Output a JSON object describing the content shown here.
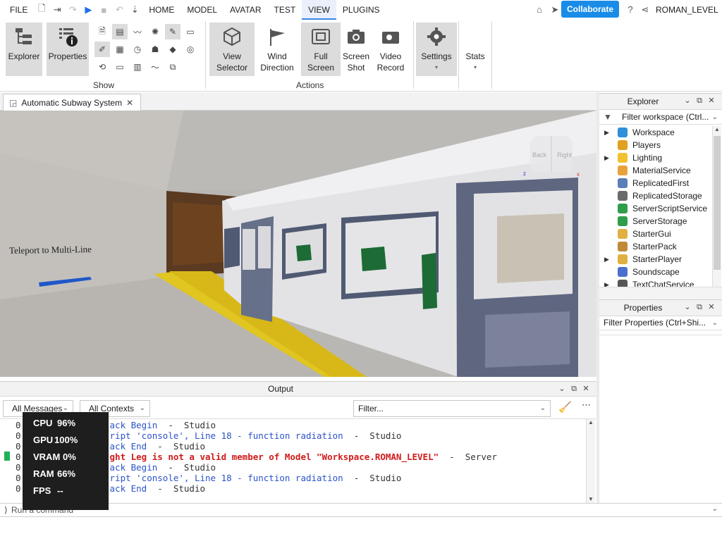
{
  "menu": {
    "items": [
      "FILE",
      "HOME",
      "MODEL",
      "AVATAR",
      "TEST",
      "VIEW",
      "PLUGINS"
    ],
    "active": "VIEW",
    "collaborate": "Collaborate",
    "username": "ROMAN_LEVEL"
  },
  "ribbon": {
    "explorer": "Explorer",
    "properties": "Properties",
    "show_group": "Show",
    "view_selector_1": "View",
    "view_selector_2": "Selector",
    "wind_1": "Wind",
    "wind_2": "Direction",
    "full_1": "Full",
    "full_2": "Screen",
    "shot_1": "Screen",
    "shot_2": "Shot",
    "video_1": "Video",
    "video_2": "Record",
    "actions_group": "Actions",
    "settings": "Settings",
    "stats": "Stats"
  },
  "doc_tab": "Automatic Subway System",
  "viewport": {
    "teleport_text": "Teleport to Multi-Line",
    "viewcube_left": "Back",
    "viewcube_right": "Right"
  },
  "output": {
    "title": "Output",
    "filter1": "All Messages",
    "filter2": "All Contexts",
    "search_placeholder": "Filter...",
    "lines": [
      {
        "prefix": "0",
        "a": "ack Begin",
        "b": "  -  Studio",
        "kind": "blue"
      },
      {
        "prefix": "0",
        "a": "ript 'console', Line 18 - function radiation",
        "b": "  -  Studio",
        "kind": "blue"
      },
      {
        "prefix": "0",
        "a": "ack End",
        "b": "  -  Studio",
        "kind": "blue"
      },
      {
        "prefix": "0",
        "a": "ght Leg is not a valid member of Model \"Workspace.ROMAN_LEVEL\"",
        "b": "  -  Server",
        "kind": "red"
      },
      {
        "prefix": "0",
        "a": "ack Begin",
        "b": "  -  Studio",
        "kind": "blue"
      },
      {
        "prefix": "0",
        "a": "ript 'console', Line 18 - function radiation",
        "b": "  -  Studio",
        "kind": "blue"
      },
      {
        "prefix": "0",
        "a": "ack End",
        "b": "  -  Studio",
        "kind": "blue"
      }
    ]
  },
  "command_placeholder": "Run a command",
  "perf": [
    {
      "label": "CPU",
      "value": "96%"
    },
    {
      "label": "GPU",
      "value": "100%"
    },
    {
      "label": "VRAM",
      "value": "0%"
    },
    {
      "label": "RAM",
      "value": "66%"
    },
    {
      "label": "FPS",
      "value": "--"
    }
  ],
  "explorer": {
    "title": "Explorer",
    "filter": "Filter workspace (Ctrl...",
    "items": [
      {
        "label": "Workspace",
        "expandable": true,
        "color": "#2f8fd8"
      },
      {
        "label": "Players",
        "expandable": false,
        "color": "#e0a020"
      },
      {
        "label": "Lighting",
        "expandable": true,
        "color": "#f2c12e"
      },
      {
        "label": "MaterialService",
        "expandable": false,
        "color": "#e8a23a"
      },
      {
        "label": "ReplicatedFirst",
        "expandable": false,
        "color": "#5a7fb8"
      },
      {
        "label": "ReplicatedStorage",
        "expandable": false,
        "color": "#6b6b6b"
      },
      {
        "label": "ServerScriptService",
        "expandable": false,
        "color": "#2f9d4a"
      },
      {
        "label": "ServerStorage",
        "expandable": false,
        "color": "#2f9d4a"
      },
      {
        "label": "StarterGui",
        "expandable": false,
        "color": "#e0b040"
      },
      {
        "label": "StarterPack",
        "expandable": false,
        "color": "#c08a3a"
      },
      {
        "label": "StarterPlayer",
        "expandable": true,
        "color": "#e0b040"
      },
      {
        "label": "Soundscape",
        "expandable": false,
        "color": "#4a6fd0"
      },
      {
        "label": "TextChatService",
        "expandable": true,
        "color": "#555555"
      }
    ]
  },
  "properties": {
    "title": "Properties",
    "filter": "Filter Properties (Ctrl+Shi..."
  }
}
